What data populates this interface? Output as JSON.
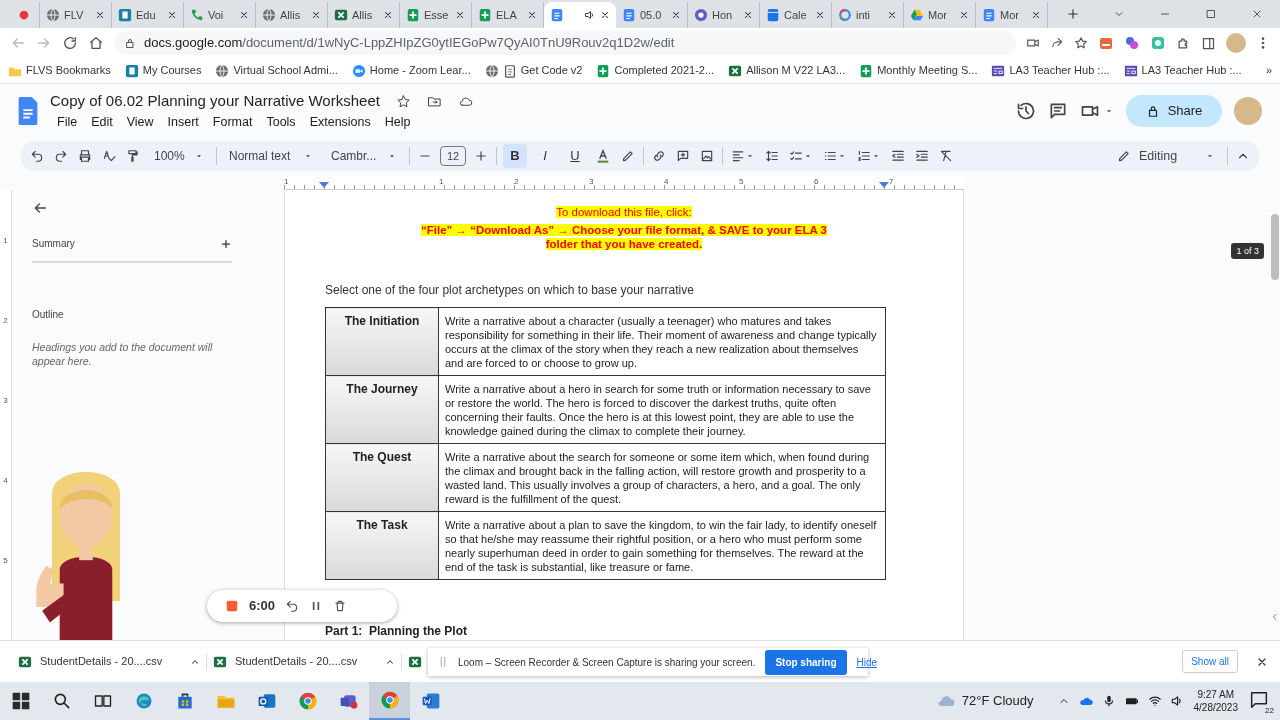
{
  "browser": {
    "tabs": [
      {
        "kind": "record",
        "selected": false,
        "audio": false
      },
      {
        "kind": "globe",
        "label": "FLV",
        "selected": false,
        "audio": false
      },
      {
        "kind": "app",
        "label": "Edu",
        "selected": false,
        "audio": false
      },
      {
        "kind": "phone",
        "label": "Voi",
        "selected": false,
        "audio": false
      },
      {
        "kind": "globe",
        "label": "Allis",
        "selected": false,
        "audio": false
      },
      {
        "kind": "excel",
        "label": "Allis",
        "selected": false,
        "audio": false
      },
      {
        "kind": "sheet",
        "label": "Esse",
        "selected": false,
        "audio": false
      },
      {
        "kind": "sheet",
        "label": "ELA",
        "selected": false,
        "audio": false
      },
      {
        "kind": "doc",
        "selected": true,
        "audio": true
      },
      {
        "kind": "doc",
        "label": "05.0",
        "selected": false,
        "audio": false
      },
      {
        "kind": "ring",
        "label": "Hon",
        "selected": false,
        "audio": false
      },
      {
        "kind": "calendar",
        "label": "Cale",
        "selected": false,
        "audio": false
      },
      {
        "kind": "gsearch",
        "label": "inti",
        "selected": false,
        "audio": false
      },
      {
        "kind": "drive",
        "label": "Mor",
        "selected": false,
        "audio": false
      },
      {
        "kind": "doc",
        "label": "Mor",
        "selected": false,
        "audio": false
      }
    ],
    "address": {
      "host": "docs.google.com",
      "path": "/document/d/1wNyC-LppZHIpZG0ytIEGoPw7QyAI0TnU9Rouv2q1D2w/edit"
    },
    "bookmarks": [
      {
        "kind": "folder",
        "label": "FLVS Bookmarks"
      },
      {
        "kind": "app",
        "label": "My Courses"
      },
      {
        "kind": "globe",
        "label": "Virtual School Admi..."
      },
      {
        "kind": "zoom",
        "label": "Home - Zoom Lear..."
      },
      {
        "kind": "globe_clipboard",
        "label": "Get Code v2"
      },
      {
        "kind": "sheet",
        "label": "Completed 2021-2..."
      },
      {
        "kind": "excel",
        "label": "Allison M V22 LA3..."
      },
      {
        "kind": "sheet",
        "label": "Monthly Meeting S..."
      },
      {
        "kind": "hub",
        "label": "LA3 Teacher Hub :..."
      },
      {
        "kind": "hub",
        "label": "LA3 Teacher Hub :..."
      }
    ],
    "more_bookmarks": "»"
  },
  "document": {
    "title": "Copy of 06.02 Planning your Narrative Worksheet",
    "menu": [
      "File",
      "Edit",
      "View",
      "Insert",
      "Format",
      "Tools",
      "Extensions",
      "Help"
    ],
    "share_label": "Share"
  },
  "toolbar": {
    "zoom": "100%",
    "style": "Normal text",
    "font": "Cambr...",
    "font_size": "12",
    "format_buttons": [
      {
        "label": "B",
        "selected": true
      },
      {
        "label": "I",
        "selected": false
      },
      {
        "label": "U",
        "selected": false
      }
    ],
    "mode": "Editing"
  },
  "ruler": {
    "horizontal": [
      "1",
      "1",
      "2",
      "3",
      "4",
      "5",
      "6",
      "7"
    ],
    "vertical": [
      "1",
      "2",
      "3",
      "4",
      "5"
    ]
  },
  "outline_panel": {
    "summary_label": "Summary",
    "outline_label": "Outline",
    "hint": "Headings you add to the document will appear here."
  },
  "page": {
    "notice_intro": "To download this file, click:",
    "notice_instructions": "“File” → “Download As” → Choose your file format, & SAVE to your ELA 3 folder that you have created.",
    "prompt": "Select one of the four plot archetypes on which to base your narrative",
    "archetypes": [
      {
        "name": "The Initiation",
        "description": "Write a narrative about a character (usually a teenager) who matures and takes responsibility for something in their life. Their moment of awareness and change typically occurs at the climax of the story when they reach a new realization about themselves and are forced to or choose to grow up."
      },
      {
        "name": "The Journey",
        "description": "Write a narrative about a hero in search for some truth or information necessary to save or restore the world. The hero is forced to discover the darkest truths, quite often concerning their faults. Once the hero is at this lowest point, they are able to use the knowledge gained during the climax to complete their journey."
      },
      {
        "name": "The Quest",
        "description": "Write a narrative about the search for someone or some item which, when found during the climax and brought back in the falling action, will restore growth and prosperity to a wasted land. This usually involves a group of characters, a hero, and a goal. The only reward is the fulfillment of the quest."
      },
      {
        "name": "The Task",
        "description": "Write a narrative about a plan to save the kingdom, to win the fair lady, to identify oneself so that he/she may reassume their rightful position, or a hero who must perform some nearly superhuman deed in order to gain something for themselves. The reward at the end of the task is substantial, like treasure or fame."
      }
    ],
    "section_heading": "Part 1:  Planning the Plot"
  },
  "page_counter": "1 of 3",
  "recorder": {
    "time": "6:00"
  },
  "downloads": [
    {
      "filename": "StudentDetails - 20....csv"
    },
    {
      "filename": "StudentDetails - 20....csv"
    }
  ],
  "show_all": "Show all",
  "loom_notice": {
    "message": "Loom – Screen Recorder & Screen Capture is sharing your screen.",
    "stop_label": "Stop sharing",
    "hide_label": "Hide"
  },
  "taskbar": {
    "apps": [
      {
        "kind": "start",
        "selected": false
      },
      {
        "kind": "search",
        "selected": false
      },
      {
        "kind": "taskview",
        "selected": false
      },
      {
        "kind": "edge",
        "selected": false
      },
      {
        "kind": "store",
        "selected": false
      },
      {
        "kind": "explorer",
        "selected": false
      },
      {
        "kind": "outlook",
        "selected": false
      },
      {
        "kind": "chrome",
        "selected": false
      },
      {
        "kind": "teams",
        "selected": false
      },
      {
        "kind": "chrome",
        "selected": true
      },
      {
        "kind": "word",
        "selected": false
      }
    ],
    "weather": "72°F  Cloudy",
    "time": "9:27 AM",
    "date": "4/28/2023",
    "notifications": "22"
  }
}
